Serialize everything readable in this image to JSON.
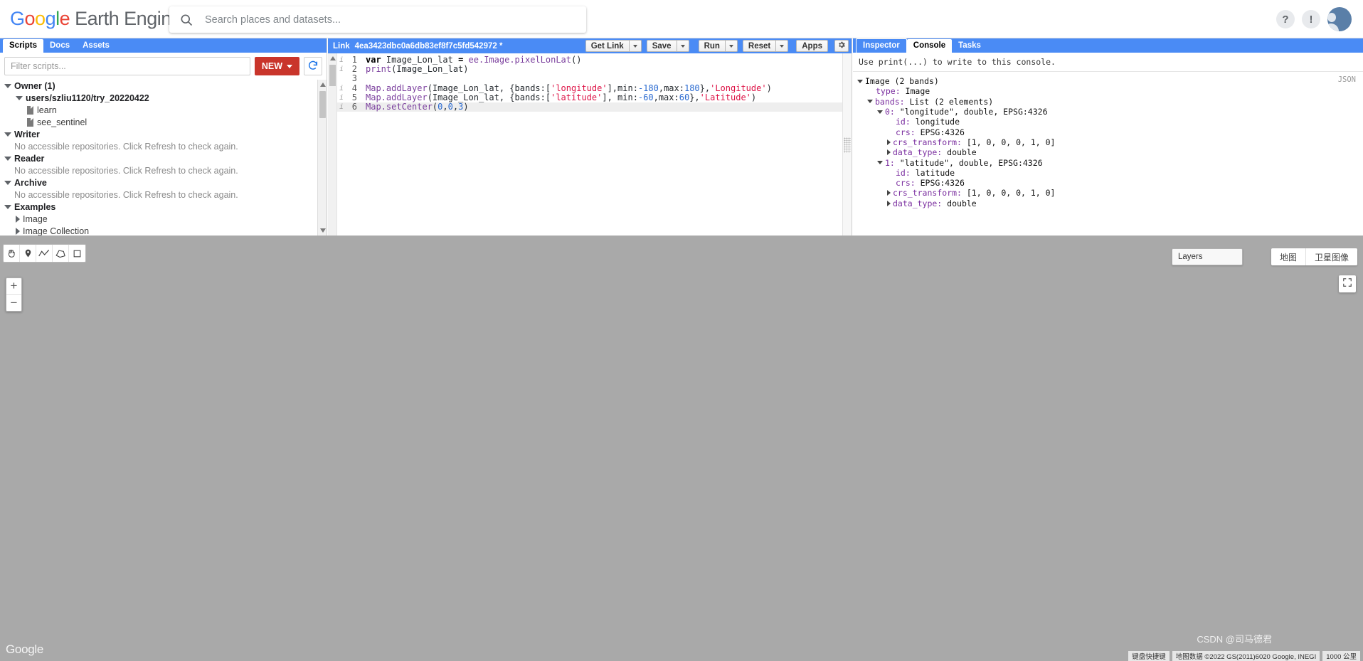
{
  "header": {
    "logo": {
      "g1": "G",
      "o1": "o",
      "o2": "o",
      "g2": "g",
      "l1": "l",
      "e1": "e",
      "suffix": " Earth Engine"
    },
    "search": {
      "placeholder": "Search places and datasets...",
      "value": "",
      "icon": "search-icon"
    },
    "help_label": "?",
    "notify_label": "!",
    "avatar_label": "account"
  },
  "left_panel": {
    "tabs": [
      {
        "label": "Scripts",
        "active": true
      },
      {
        "label": "Docs",
        "active": false
      },
      {
        "label": "Assets",
        "active": false
      }
    ],
    "filter": {
      "placeholder": "Filter scripts...",
      "value": ""
    },
    "new_button": "NEW",
    "refresh_icon": "refresh-icon",
    "groups": [
      {
        "label": "Owner (1)",
        "expanded": true,
        "repo": "users/szliu1120/try_20220422",
        "files": [
          "learn",
          "see_sentinel"
        ]
      },
      {
        "label": "Writer",
        "expanded": true,
        "message": "No accessible repositories. Click Refresh to check again."
      },
      {
        "label": "Reader",
        "expanded": true,
        "message": "No accessible repositories. Click Refresh to check again."
      },
      {
        "label": "Archive",
        "expanded": true,
        "message": "No accessible repositories. Click Refresh to check again."
      },
      {
        "label": "Examples",
        "expanded": true,
        "children": [
          "Image",
          "Image Collection"
        ]
      }
    ]
  },
  "code_panel": {
    "link_prefix": "Link",
    "link_id": "4ea3423dbc0a6db83ef8f7c5fd542972 *",
    "buttons": {
      "get_link": "Get Link",
      "save": "Save",
      "run": "Run",
      "reset": "Reset",
      "apps": "Apps",
      "settings_icon": "gear-icon"
    },
    "lines": [
      {
        "num": "1",
        "info": true,
        "highlight": false,
        "tokens": [
          {
            "t": "var ",
            "c": "kw"
          },
          {
            "t": "Image_Lon_lat ",
            "c": "plain"
          },
          {
            "t": "= ",
            "c": "kw"
          },
          {
            "t": "ee.Image.pixelLonLat",
            "c": "fn"
          },
          {
            "t": "()",
            "c": "plain"
          }
        ]
      },
      {
        "num": "2",
        "info": true,
        "highlight": false,
        "tokens": [
          {
            "t": "print",
            "c": "fn"
          },
          {
            "t": "(Image_Lon_lat)",
            "c": "plain"
          }
        ]
      },
      {
        "num": "3",
        "info": false,
        "highlight": false,
        "tokens": []
      },
      {
        "num": "4",
        "info": true,
        "highlight": false,
        "tokens": [
          {
            "t": "Map.addLayer",
            "c": "fn"
          },
          {
            "t": "(Image_Lon_lat, {bands:[",
            "c": "plain"
          },
          {
            "t": "'longitude'",
            "c": "str"
          },
          {
            "t": "],min:",
            "c": "plain"
          },
          {
            "t": "-180",
            "c": "num"
          },
          {
            "t": ",max:",
            "c": "plain"
          },
          {
            "t": "180",
            "c": "num"
          },
          {
            "t": "},",
            "c": "plain"
          },
          {
            "t": "'Longitude'",
            "c": "str"
          },
          {
            "t": ")",
            "c": "plain"
          }
        ]
      },
      {
        "num": "5",
        "info": true,
        "highlight": false,
        "tokens": [
          {
            "t": "Map.addLayer",
            "c": "fn"
          },
          {
            "t": "(Image_Lon_lat, {bands:[",
            "c": "plain"
          },
          {
            "t": "'latitude'",
            "c": "str"
          },
          {
            "t": "], min:",
            "c": "plain"
          },
          {
            "t": "-60",
            "c": "num"
          },
          {
            "t": ",max:",
            "c": "plain"
          },
          {
            "t": "60",
            "c": "num"
          },
          {
            "t": "},",
            "c": "plain"
          },
          {
            "t": "'Latitude'",
            "c": "str"
          },
          {
            "t": ")",
            "c": "plain"
          }
        ]
      },
      {
        "num": "6",
        "info": true,
        "highlight": true,
        "tokens": [
          {
            "t": "Map.setCenter",
            "c": "fn"
          },
          {
            "t": "(",
            "c": "plain"
          },
          {
            "t": "0",
            "c": "num"
          },
          {
            "t": ",",
            "c": "plain"
          },
          {
            "t": "0",
            "c": "num"
          },
          {
            "t": ",",
            "c": "plain"
          },
          {
            "t": "3",
            "c": "num"
          },
          {
            "t": ")",
            "c": "plain"
          }
        ]
      }
    ]
  },
  "right_panel": {
    "tabs": [
      {
        "label": "Inspector",
        "active": false
      },
      {
        "label": "Console",
        "active": true
      },
      {
        "label": "Tasks",
        "active": false
      }
    ],
    "hint": "Use print(...) to write to this console.",
    "json_label": "JSON",
    "tree": [
      {
        "indent": 0,
        "tri": "down",
        "key": "",
        "value": "Image (2 bands)"
      },
      {
        "indent": 1,
        "tri": "none",
        "key": "type:",
        "value": " Image"
      },
      {
        "indent": 1,
        "tri": "down",
        "key": "bands:",
        "value": " List (2 elements)"
      },
      {
        "indent": 2,
        "tri": "down",
        "key": "0:",
        "value": " \"longitude\", double, EPSG:4326"
      },
      {
        "indent": 3,
        "tri": "none",
        "key": "id:",
        "value": " longitude"
      },
      {
        "indent": 3,
        "tri": "none",
        "key": "crs:",
        "value": " EPSG:4326"
      },
      {
        "indent": 3,
        "tri": "right",
        "key": "crs_transform:",
        "value": " [1, 0, 0, 0, 1, 0]"
      },
      {
        "indent": 3,
        "tri": "right",
        "key": "data_type:",
        "value": " double"
      },
      {
        "indent": 2,
        "tri": "down",
        "key": "1:",
        "value": " \"latitude\", double, EPSG:4326"
      },
      {
        "indent": 3,
        "tri": "none",
        "key": "id:",
        "value": " latitude"
      },
      {
        "indent": 3,
        "tri": "none",
        "key": "crs:",
        "value": " EPSG:4326"
      },
      {
        "indent": 3,
        "tri": "right",
        "key": "crs_transform:",
        "value": " [1, 0, 0, 0, 1, 0]"
      },
      {
        "indent": 3,
        "tri": "right",
        "key": "data_type:",
        "value": " double"
      }
    ]
  },
  "map": {
    "tools": [
      "hand-icon",
      "marker-icon",
      "line-icon",
      "polygon-icon",
      "rectangle-icon"
    ],
    "zoom_in": "+",
    "zoom_out": "−",
    "layers_label": "Layers",
    "maptypes": [
      "地图",
      "卫星图像"
    ],
    "fullscreen_icon": "fullscreen-icon",
    "google_watermark": "Google",
    "bottom_bar": [
      "键盘快捷键",
      "地图数据 ©2022 GS(2011)6020 Google, INEGI",
      "1000 公里"
    ],
    "corner_watermark": "CSDN @司马德君"
  }
}
